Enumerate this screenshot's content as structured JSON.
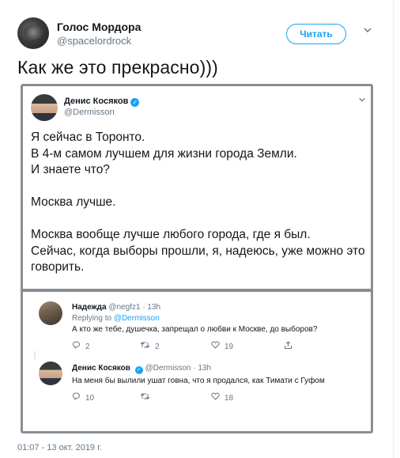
{
  "author": {
    "name": "Голос Мордора",
    "handle": "@spacelordrock",
    "follow_label": "Читать"
  },
  "tweet": {
    "text": "Как же это прекрасно)))",
    "timestamp": "01:07 - 13 окт. 2019 г."
  },
  "quoted": {
    "name": "Денис Косяков",
    "handle": "@Dermisson",
    "body": [
      "Я сейчас в Торонто.\nВ 4-м самом лучшем для жизни города Земли.\nИ знаете что?",
      "Москва лучше.",
      "Москва вообще лучше любого города, где я был.\nСейчас, когда выборы прошли, я, надеюсь, уже можно это говорить."
    ]
  },
  "replies": [
    {
      "name": "Надежда",
      "handle": "@negfz1",
      "time": "· 13h",
      "replying_prefix": "Replying to",
      "replying_to": "@Dermisson",
      "text": "А кто же тебе, душечка, запрещал о любви к Москве, до выборов?",
      "reply_count": "2",
      "retweet_count": "2",
      "like_count": "19"
    },
    {
      "name": "Денис Косяков",
      "handle": "@Dermisson",
      "time": "· 13h",
      "text": "На меня бы вылили ушат говна, что я продался, как Тимати с Гуфом",
      "reply_count": "10",
      "retweet_count": "",
      "like_count": "18"
    }
  ],
  "icons": {
    "caret": "chevron-down-icon",
    "verified": "verified-badge-icon",
    "reply": "reply-icon",
    "retweet": "retweet-icon",
    "like": "heart-icon",
    "share": "share-icon"
  },
  "colors": {
    "accent": "#1da1f2",
    "muted": "#657786",
    "text": "#14171a",
    "quote_border": "#888e93"
  }
}
